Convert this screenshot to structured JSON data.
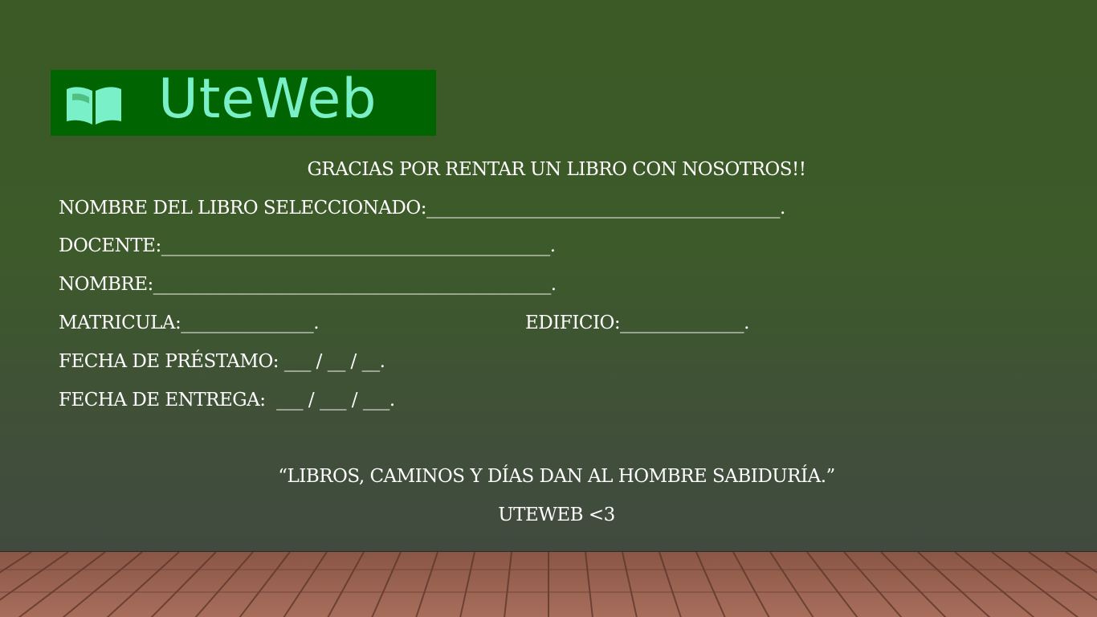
{
  "logo": {
    "brand_text": "UteWeb",
    "icon": "open-book-icon",
    "background_color": "#006400",
    "text_color": "#7af0c8"
  },
  "heading": "GRACIAS POR RENTAR UN LIBRO CON NOSOTROS!!",
  "form": {
    "book_name": "NOMBRE DEL LIBRO SELECCIONADO:________________________________________.",
    "teacher": "DOCENTE:____________________________________________.",
    "name": "NOMBRE:_____________________________________________.",
    "enrollment": "MATRICULA:_______________.",
    "building": "EDIFICIO:______________.",
    "loan_date": "FECHA DE PRÉSTAMO: ___ / __ / __.",
    "return_date": "FECHA DE ENTREGA:  ___ / ___ / ___."
  },
  "quote": "“LIBROS, CAMINOS Y DÍAS DAN AL HOMBRE SABIDURÍA.”",
  "signature": "UTEWEB <3",
  "colors": {
    "background": "#3b5a25",
    "text": "#ffffff",
    "floor": "#9b6453"
  }
}
